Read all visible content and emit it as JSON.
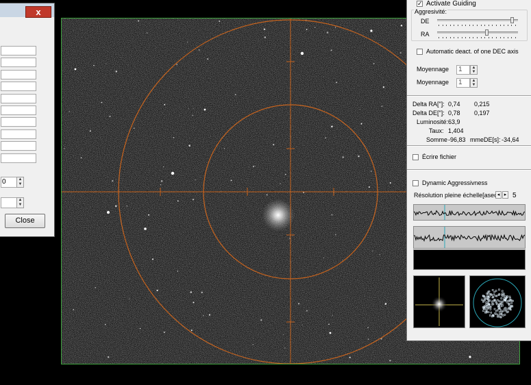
{
  "dialog": {
    "close_x": "x",
    "field_count": 10,
    "spin_values": [
      "0",
      ""
    ],
    "close_button": "Close"
  },
  "panel": {
    "activate_guiding": {
      "label": "Activate Guiding",
      "checked": true
    },
    "aggressivity": {
      "title": "Aggresivité:",
      "de_label": "DE",
      "ra_label": "RA",
      "de_level": 0.95,
      "ra_level": 0.62
    },
    "auto_deact": {
      "label": "Automatic deact. of one DEC axis",
      "checked": false
    },
    "moyennage_1": {
      "label": "Moyennage",
      "value": "1"
    },
    "moyennage_2": {
      "label": "Moyennage",
      "value": "1"
    },
    "stats": {
      "delta_ra_label": "Delta RA[\"]:",
      "delta_ra_1": "0,74",
      "delta_ra_2": "0,215",
      "delta_de_label": "Delta DE[\"]:",
      "delta_de_1": "0,78",
      "delta_de_2": "0,197",
      "luminosite_label": "Luminosité:",
      "luminosite": "63,9",
      "taux_label": "Taux:",
      "taux": "1,404",
      "somme_label": "Somme",
      "somme": "-96,83",
      "somme_de_label": "mmeDE[s]:",
      "somme_de": "-34,64"
    },
    "ecrire": {
      "label": "Écrire fichier",
      "checked": false
    },
    "dynamic": {
      "label": "Dynamic Aggressivness",
      "checked": false
    },
    "resolution": {
      "label": "Résolution pleine échelle[asec]:",
      "value": "5",
      "left_arrow": "◂",
      "right_arrow": "▸"
    }
  },
  "colors": {
    "reticle": "#c8641e",
    "frame": "#3fa33f",
    "graph_marker": "#2aa8b8",
    "scatter": "#d7e6f0"
  }
}
